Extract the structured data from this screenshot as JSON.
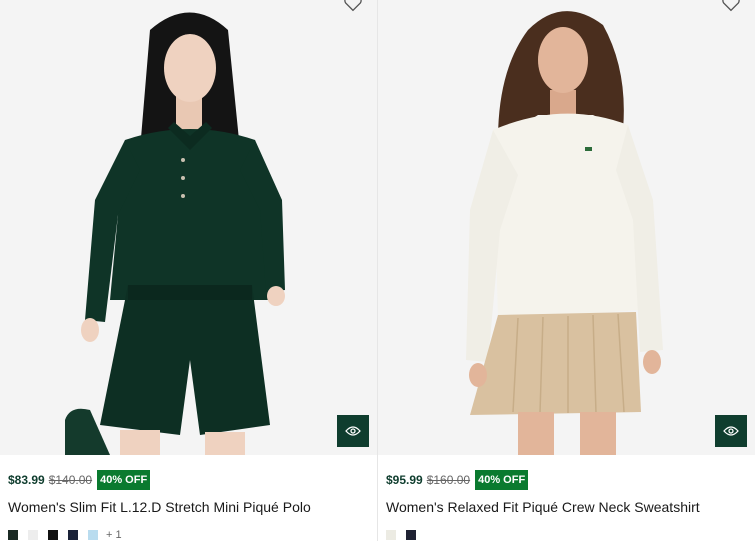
{
  "colors": {
    "brand_green": "#0f3d2e",
    "discount_badge": "#0a7a2f"
  },
  "products": [
    {
      "price": "$83.99",
      "original_price": "$140.00",
      "discount": "40% OFF",
      "title": "Women's Slim Fit L.12.D Stretch Mini Piqué Polo",
      "swatches": [
        "#1b2a24",
        "#ededed",
        "#111111",
        "#1a2238",
        "#b9dcef"
      ],
      "more_swatches": "+ 1",
      "wishlist_icon": "heart-icon",
      "quickview_icon": "eye-icon"
    },
    {
      "price": "$95.99",
      "original_price": "$160.00",
      "discount": "40% OFF",
      "title": "Women's Relaxed Fit Piqué Crew Neck Sweatshirt",
      "swatches": [
        "#ecebe3",
        "#1f2233"
      ],
      "wishlist_icon": "heart-icon",
      "quickview_icon": "eye-icon"
    }
  ]
}
